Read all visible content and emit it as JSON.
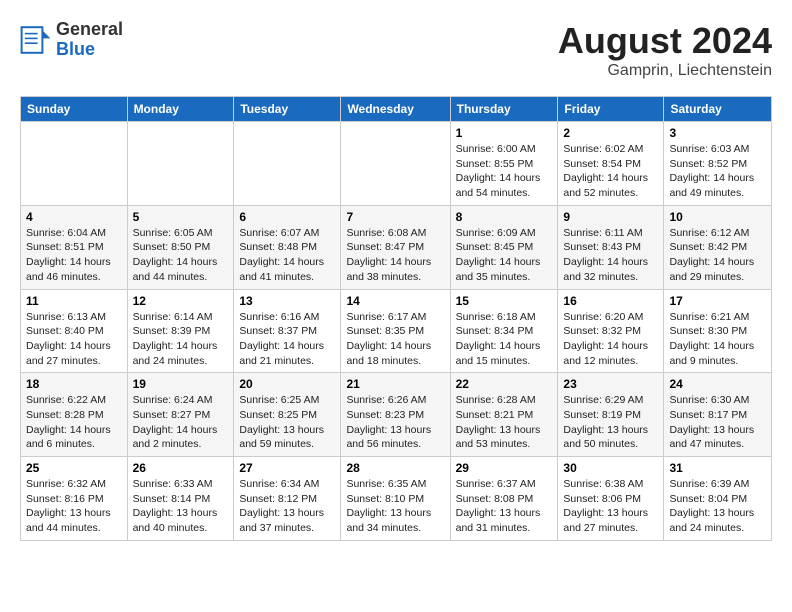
{
  "header": {
    "logo_general": "General",
    "logo_blue": "Blue",
    "title": "August 2024",
    "subtitle": "Gamprin, Liechtenstein"
  },
  "calendar": {
    "days_of_week": [
      "Sunday",
      "Monday",
      "Tuesday",
      "Wednesday",
      "Thursday",
      "Friday",
      "Saturday"
    ],
    "weeks": [
      [
        {
          "day": "",
          "info": ""
        },
        {
          "day": "",
          "info": ""
        },
        {
          "day": "",
          "info": ""
        },
        {
          "day": "",
          "info": ""
        },
        {
          "day": "1",
          "info": "Sunrise: 6:00 AM\nSunset: 8:55 PM\nDaylight: 14 hours\nand 54 minutes."
        },
        {
          "day": "2",
          "info": "Sunrise: 6:02 AM\nSunset: 8:54 PM\nDaylight: 14 hours\nand 52 minutes."
        },
        {
          "day": "3",
          "info": "Sunrise: 6:03 AM\nSunset: 8:52 PM\nDaylight: 14 hours\nand 49 minutes."
        }
      ],
      [
        {
          "day": "4",
          "info": "Sunrise: 6:04 AM\nSunset: 8:51 PM\nDaylight: 14 hours\nand 46 minutes."
        },
        {
          "day": "5",
          "info": "Sunrise: 6:05 AM\nSunset: 8:50 PM\nDaylight: 14 hours\nand 44 minutes."
        },
        {
          "day": "6",
          "info": "Sunrise: 6:07 AM\nSunset: 8:48 PM\nDaylight: 14 hours\nand 41 minutes."
        },
        {
          "day": "7",
          "info": "Sunrise: 6:08 AM\nSunset: 8:47 PM\nDaylight: 14 hours\nand 38 minutes."
        },
        {
          "day": "8",
          "info": "Sunrise: 6:09 AM\nSunset: 8:45 PM\nDaylight: 14 hours\nand 35 minutes."
        },
        {
          "day": "9",
          "info": "Sunrise: 6:11 AM\nSunset: 8:43 PM\nDaylight: 14 hours\nand 32 minutes."
        },
        {
          "day": "10",
          "info": "Sunrise: 6:12 AM\nSunset: 8:42 PM\nDaylight: 14 hours\nand 29 minutes."
        }
      ],
      [
        {
          "day": "11",
          "info": "Sunrise: 6:13 AM\nSunset: 8:40 PM\nDaylight: 14 hours\nand 27 minutes."
        },
        {
          "day": "12",
          "info": "Sunrise: 6:14 AM\nSunset: 8:39 PM\nDaylight: 14 hours\nand 24 minutes."
        },
        {
          "day": "13",
          "info": "Sunrise: 6:16 AM\nSunset: 8:37 PM\nDaylight: 14 hours\nand 21 minutes."
        },
        {
          "day": "14",
          "info": "Sunrise: 6:17 AM\nSunset: 8:35 PM\nDaylight: 14 hours\nand 18 minutes."
        },
        {
          "day": "15",
          "info": "Sunrise: 6:18 AM\nSunset: 8:34 PM\nDaylight: 14 hours\nand 15 minutes."
        },
        {
          "day": "16",
          "info": "Sunrise: 6:20 AM\nSunset: 8:32 PM\nDaylight: 14 hours\nand 12 minutes."
        },
        {
          "day": "17",
          "info": "Sunrise: 6:21 AM\nSunset: 8:30 PM\nDaylight: 14 hours\nand 9 minutes."
        }
      ],
      [
        {
          "day": "18",
          "info": "Sunrise: 6:22 AM\nSunset: 8:28 PM\nDaylight: 14 hours\nand 6 minutes."
        },
        {
          "day": "19",
          "info": "Sunrise: 6:24 AM\nSunset: 8:27 PM\nDaylight: 14 hours\nand 2 minutes."
        },
        {
          "day": "20",
          "info": "Sunrise: 6:25 AM\nSunset: 8:25 PM\nDaylight: 13 hours\nand 59 minutes."
        },
        {
          "day": "21",
          "info": "Sunrise: 6:26 AM\nSunset: 8:23 PM\nDaylight: 13 hours\nand 56 minutes."
        },
        {
          "day": "22",
          "info": "Sunrise: 6:28 AM\nSunset: 8:21 PM\nDaylight: 13 hours\nand 53 minutes."
        },
        {
          "day": "23",
          "info": "Sunrise: 6:29 AM\nSunset: 8:19 PM\nDaylight: 13 hours\nand 50 minutes."
        },
        {
          "day": "24",
          "info": "Sunrise: 6:30 AM\nSunset: 8:17 PM\nDaylight: 13 hours\nand 47 minutes."
        }
      ],
      [
        {
          "day": "25",
          "info": "Sunrise: 6:32 AM\nSunset: 8:16 PM\nDaylight: 13 hours\nand 44 minutes."
        },
        {
          "day": "26",
          "info": "Sunrise: 6:33 AM\nSunset: 8:14 PM\nDaylight: 13 hours\nand 40 minutes."
        },
        {
          "day": "27",
          "info": "Sunrise: 6:34 AM\nSunset: 8:12 PM\nDaylight: 13 hours\nand 37 minutes."
        },
        {
          "day": "28",
          "info": "Sunrise: 6:35 AM\nSunset: 8:10 PM\nDaylight: 13 hours\nand 34 minutes."
        },
        {
          "day": "29",
          "info": "Sunrise: 6:37 AM\nSunset: 8:08 PM\nDaylight: 13 hours\nand 31 minutes."
        },
        {
          "day": "30",
          "info": "Sunrise: 6:38 AM\nSunset: 8:06 PM\nDaylight: 13 hours\nand 27 minutes."
        },
        {
          "day": "31",
          "info": "Sunrise: 6:39 AM\nSunset: 8:04 PM\nDaylight: 13 hours\nand 24 minutes."
        }
      ]
    ]
  }
}
